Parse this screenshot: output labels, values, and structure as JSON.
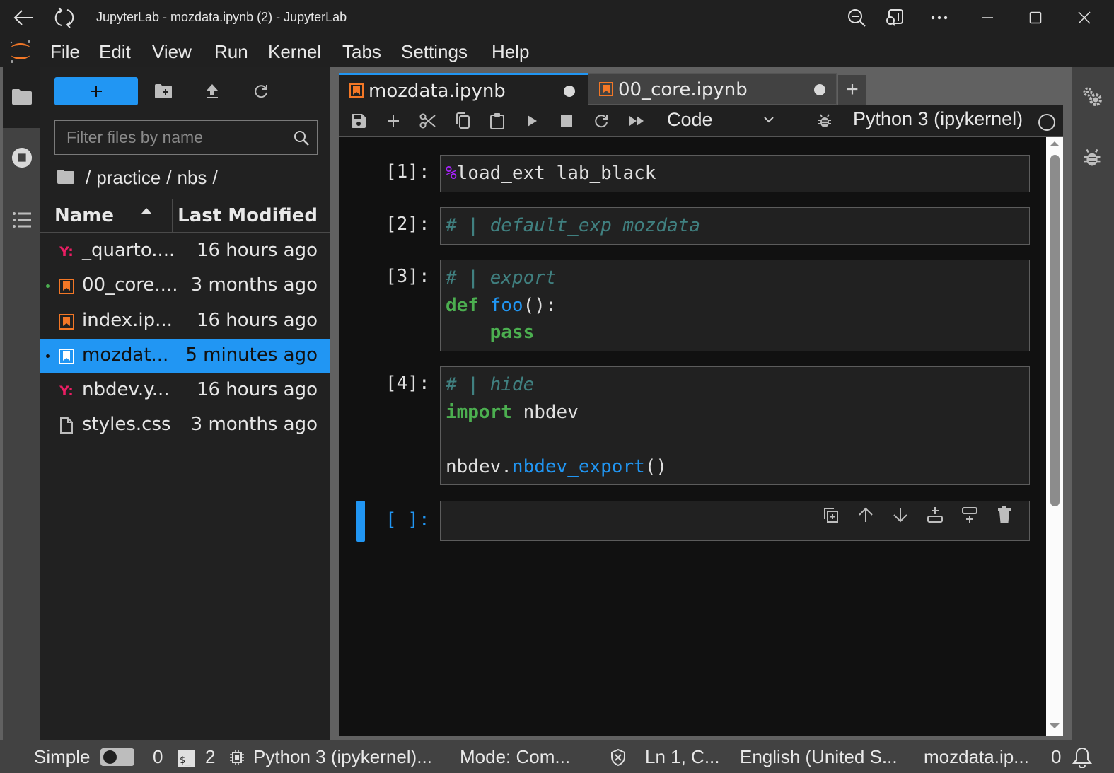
{
  "window": {
    "title": "JupyterLab - mozdata.ipynb (2) - JupyterLab"
  },
  "menu": {
    "items": [
      "File",
      "Edit",
      "View",
      "Run",
      "Kernel",
      "Tabs",
      "Settings",
      "Help"
    ]
  },
  "filebrowser": {
    "new_launcher_label": "+",
    "filter_placeholder": "Filter files by name",
    "filter_value": "",
    "breadcrumb": [
      "practice",
      "nbs"
    ],
    "columns": {
      "name": "Name",
      "modified": "Last Modified"
    },
    "sort": {
      "column": "Name",
      "direction": "ascending"
    },
    "files": [
      {
        "name": "_quarto....",
        "modified": "16 hours ago",
        "type": "yaml",
        "running": false,
        "selected": false
      },
      {
        "name": "00_core....",
        "modified": "3 months ago",
        "type": "notebook",
        "running": true,
        "selected": false
      },
      {
        "name": "index.ip...",
        "modified": "16 hours ago",
        "type": "notebook",
        "running": false,
        "selected": false
      },
      {
        "name": "mozdat...",
        "modified": "5 minutes ago",
        "type": "notebook",
        "running": true,
        "selected": true
      },
      {
        "name": "nbdev.y...",
        "modified": "16 hours ago",
        "type": "yaml",
        "running": false,
        "selected": false
      },
      {
        "name": "styles.css",
        "modified": "3 months ago",
        "type": "file",
        "running": false,
        "selected": false
      }
    ]
  },
  "notebook": {
    "tabs": [
      {
        "label": "mozdata.ipynb",
        "active": true,
        "dirty": true
      },
      {
        "label": "00_core.ipynb",
        "active": false,
        "dirty": true
      }
    ],
    "add_tab_label": "+",
    "cell_type": "Code",
    "kernel_name": "Python 3 (ipykernel)",
    "kernel_status": "idle",
    "cells": [
      {
        "prompt": "[1]:",
        "lines": [
          [
            {
              "t": "magic",
              "v": "%"
            },
            {
              "t": "plain",
              "v": "load_ext lab_black"
            }
          ]
        ]
      },
      {
        "prompt": "[2]:",
        "lines": [
          [
            {
              "t": "comment",
              "v": "# | default_exp mozdata"
            }
          ]
        ]
      },
      {
        "prompt": "[3]:",
        "lines": [
          [
            {
              "t": "comment",
              "v": "# | export"
            }
          ],
          [
            {
              "t": "kw",
              "v": "def"
            },
            {
              "t": "plain",
              "v": " "
            },
            {
              "t": "def",
              "v": "foo"
            },
            {
              "t": "plain",
              "v": "():"
            }
          ],
          [
            {
              "t": "plain",
              "v": "    "
            },
            {
              "t": "kw",
              "v": "pass"
            }
          ]
        ]
      },
      {
        "prompt": "[4]:",
        "lines": [
          [
            {
              "t": "comment",
              "v": "# | hide"
            }
          ],
          [
            {
              "t": "kw",
              "v": "import"
            },
            {
              "t": "plain",
              "v": " nbdev"
            }
          ],
          [
            {
              "t": "plain",
              "v": " "
            }
          ],
          [
            {
              "t": "plain",
              "v": "nbdev."
            },
            {
              "t": "fn",
              "v": "nbdev_export"
            },
            {
              "t": "plain",
              "v": "()"
            }
          ]
        ]
      },
      {
        "prompt": "[ ]:",
        "lines": [],
        "active": true
      }
    ]
  },
  "statusbar": {
    "mode_label": "Simple",
    "simple_mode_on": false,
    "kernels_count": "0",
    "terminals_count": "2",
    "kernel": "Python 3 (ipykernel)...",
    "mode": "Mode: Com...",
    "position": "Ln 1, C...",
    "language": "English (United S...",
    "file": "mozdata.ip...",
    "notifications": "0"
  },
  "colors": {
    "accent": "#2196f3",
    "notebook_icon": "#f37726",
    "yaml_icon": "#e91e63",
    "running_dot": "#4caf50",
    "keyword": "#4caf50",
    "comment": "#408080",
    "magic": "#aa22ff"
  }
}
